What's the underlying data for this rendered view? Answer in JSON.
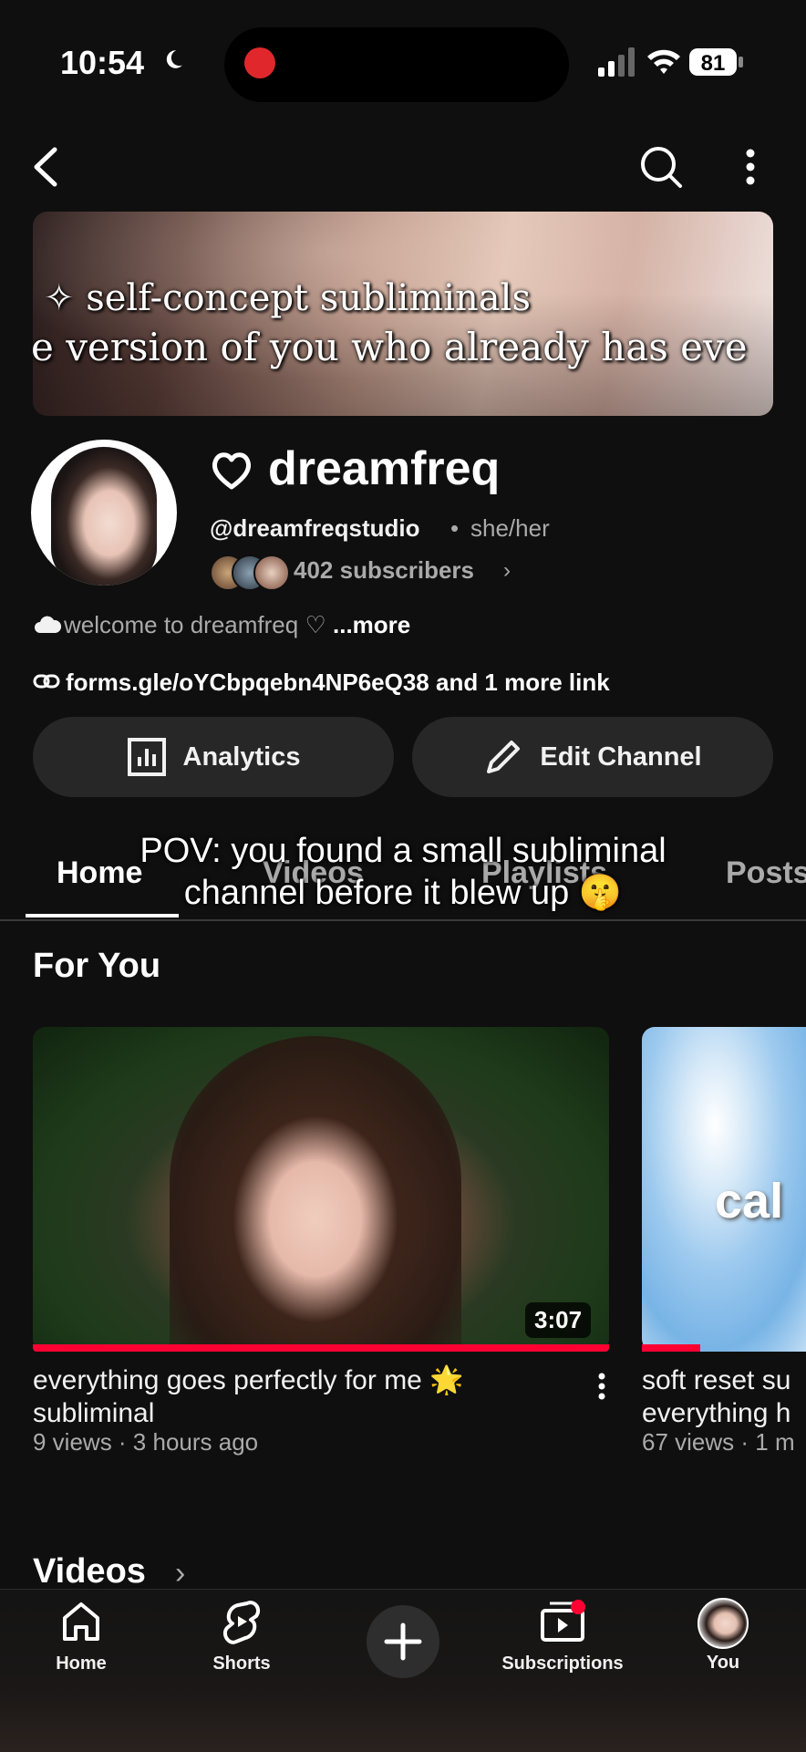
{
  "status_bar": {
    "time": "10:54",
    "battery": "81"
  },
  "banner": {
    "line1": "✧ self-concept subliminals",
    "line2": "e version of you who already has eve"
  },
  "channel": {
    "name": "dreamfreq",
    "handle": "@dreamfreqstudio",
    "separator": "•",
    "pronouns": "she/her",
    "subscribers": "402 subscribers",
    "description": "welcome to dreamfreq ♡",
    "more": "...more",
    "link": "forms.gle/oYCbpqebn4NP6eQ38 and 1 more link"
  },
  "actions": {
    "analytics": "Analytics",
    "edit": "Edit Channel"
  },
  "tabs": [
    "Home",
    "Videos",
    "Playlists",
    "Posts"
  ],
  "overlay_caption": {
    "line1": "POV: you found a small subliminal",
    "line2": "channel before it blew up 🤫"
  },
  "for_you": {
    "title": "For You",
    "videos": [
      {
        "title": "everything goes perfectly for me 🌟 subliminal",
        "meta": "9 views · 3 hours ago",
        "duration": "3:07",
        "progress": 1.0
      },
      {
        "title": "soft reset su",
        "title2": "everything h",
        "meta": "67 views · 1 m",
        "thumb_text": "cal",
        "progress": 0.15
      }
    ]
  },
  "videos_section": {
    "title": "Videos"
  },
  "bottom_nav": {
    "home": "Home",
    "shorts": "Shorts",
    "subscriptions": "Subscriptions",
    "you": "You"
  },
  "colors": {
    "background": "#0f0f0f",
    "accent_red": "#ff0033",
    "recording_red": "#e0282c"
  }
}
